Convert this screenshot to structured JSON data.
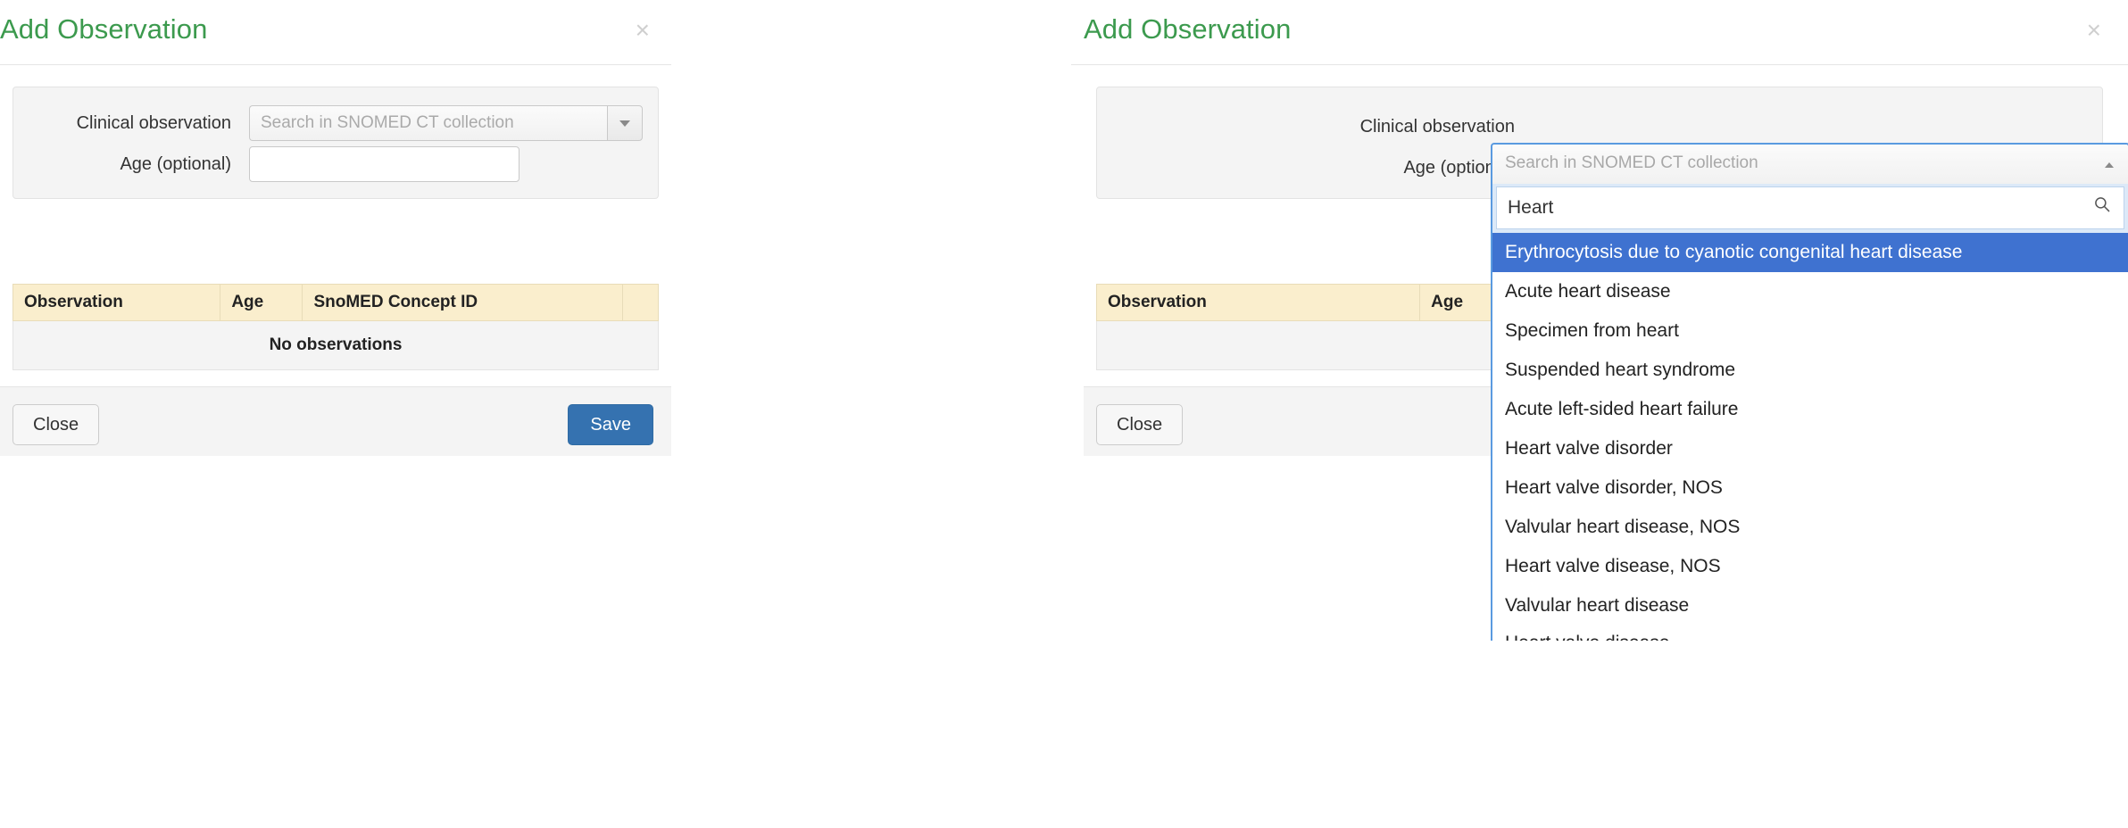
{
  "modals": {
    "left": {
      "title": "Add Observation",
      "close_icon_label": "×",
      "form": {
        "observation_label": "Clinical observation",
        "observation_placeholder": "Search in SNOMED CT collection",
        "observation_value": "",
        "age_label": "Age (optional)",
        "age_value": "",
        "age_placeholder": ""
      },
      "table": {
        "columns": [
          "Observation",
          "Age",
          "SnoMED Concept ID",
          ""
        ],
        "empty_text": "No observations",
        "rows": []
      },
      "footer": {
        "close_label": "Close",
        "save_label": "Save"
      }
    },
    "right": {
      "title": "Add Observation",
      "close_icon_label": "×",
      "form": {
        "observation_label": "Clinical observation",
        "observation_placeholder": "Search in SNOMED CT collection",
        "age_label": "Age (optional)"
      },
      "table": {
        "columns": [
          "Observation",
          "Age"
        ],
        "empty_text": ""
      },
      "footer": {
        "close_label": "Close"
      },
      "typeahead": {
        "face_text": "Search in SNOMED CT collection",
        "search_value": "Heart",
        "search_placeholder": "",
        "active_index": 0,
        "options": [
          "Erythrocytosis due to cyanotic congenital heart disease",
          "Acute heart disease",
          "Specimen from heart",
          "Suspended heart syndrome",
          "Acute left-sided heart failure",
          "Heart valve disorder",
          "Heart valve disorder, NOS",
          "Valvular heart disease, NOS",
          "Heart valve disease, NOS",
          "Valvular heart disease"
        ],
        "partial_option": "Heart valve disease"
      }
    }
  },
  "colors": {
    "title_green": "#3c9a4e",
    "primary_blue": "#3572b0",
    "highlight_blue": "#3f72d0",
    "focus_border": "#5a9ae0",
    "table_header_cream": "#faeecd"
  }
}
